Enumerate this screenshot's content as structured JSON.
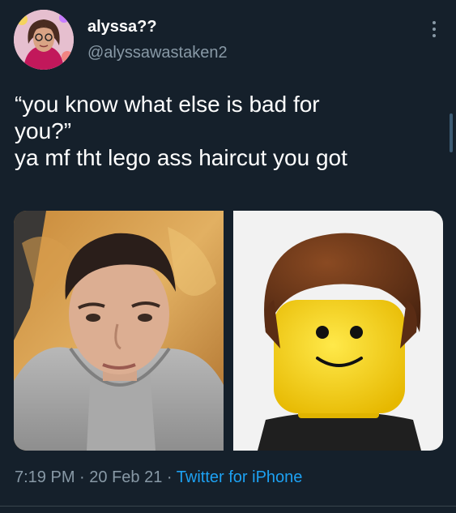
{
  "tweet": {
    "display_name": "alyssa??",
    "handle": "@alyssawastaken2",
    "text_lines": [
      "“you know what else is bad for",
      "you?”",
      "ya mf tht lego ass haircut you got"
    ],
    "time": "7:19 PM",
    "date": "20 Feb 21",
    "separator": "·",
    "source": "Twitter for iPhone"
  },
  "colors": {
    "background": "#15202b",
    "secondary_text": "#8899a6",
    "link": "#1da1f2"
  },
  "icons": {
    "menu": "more-vertical-icon"
  }
}
